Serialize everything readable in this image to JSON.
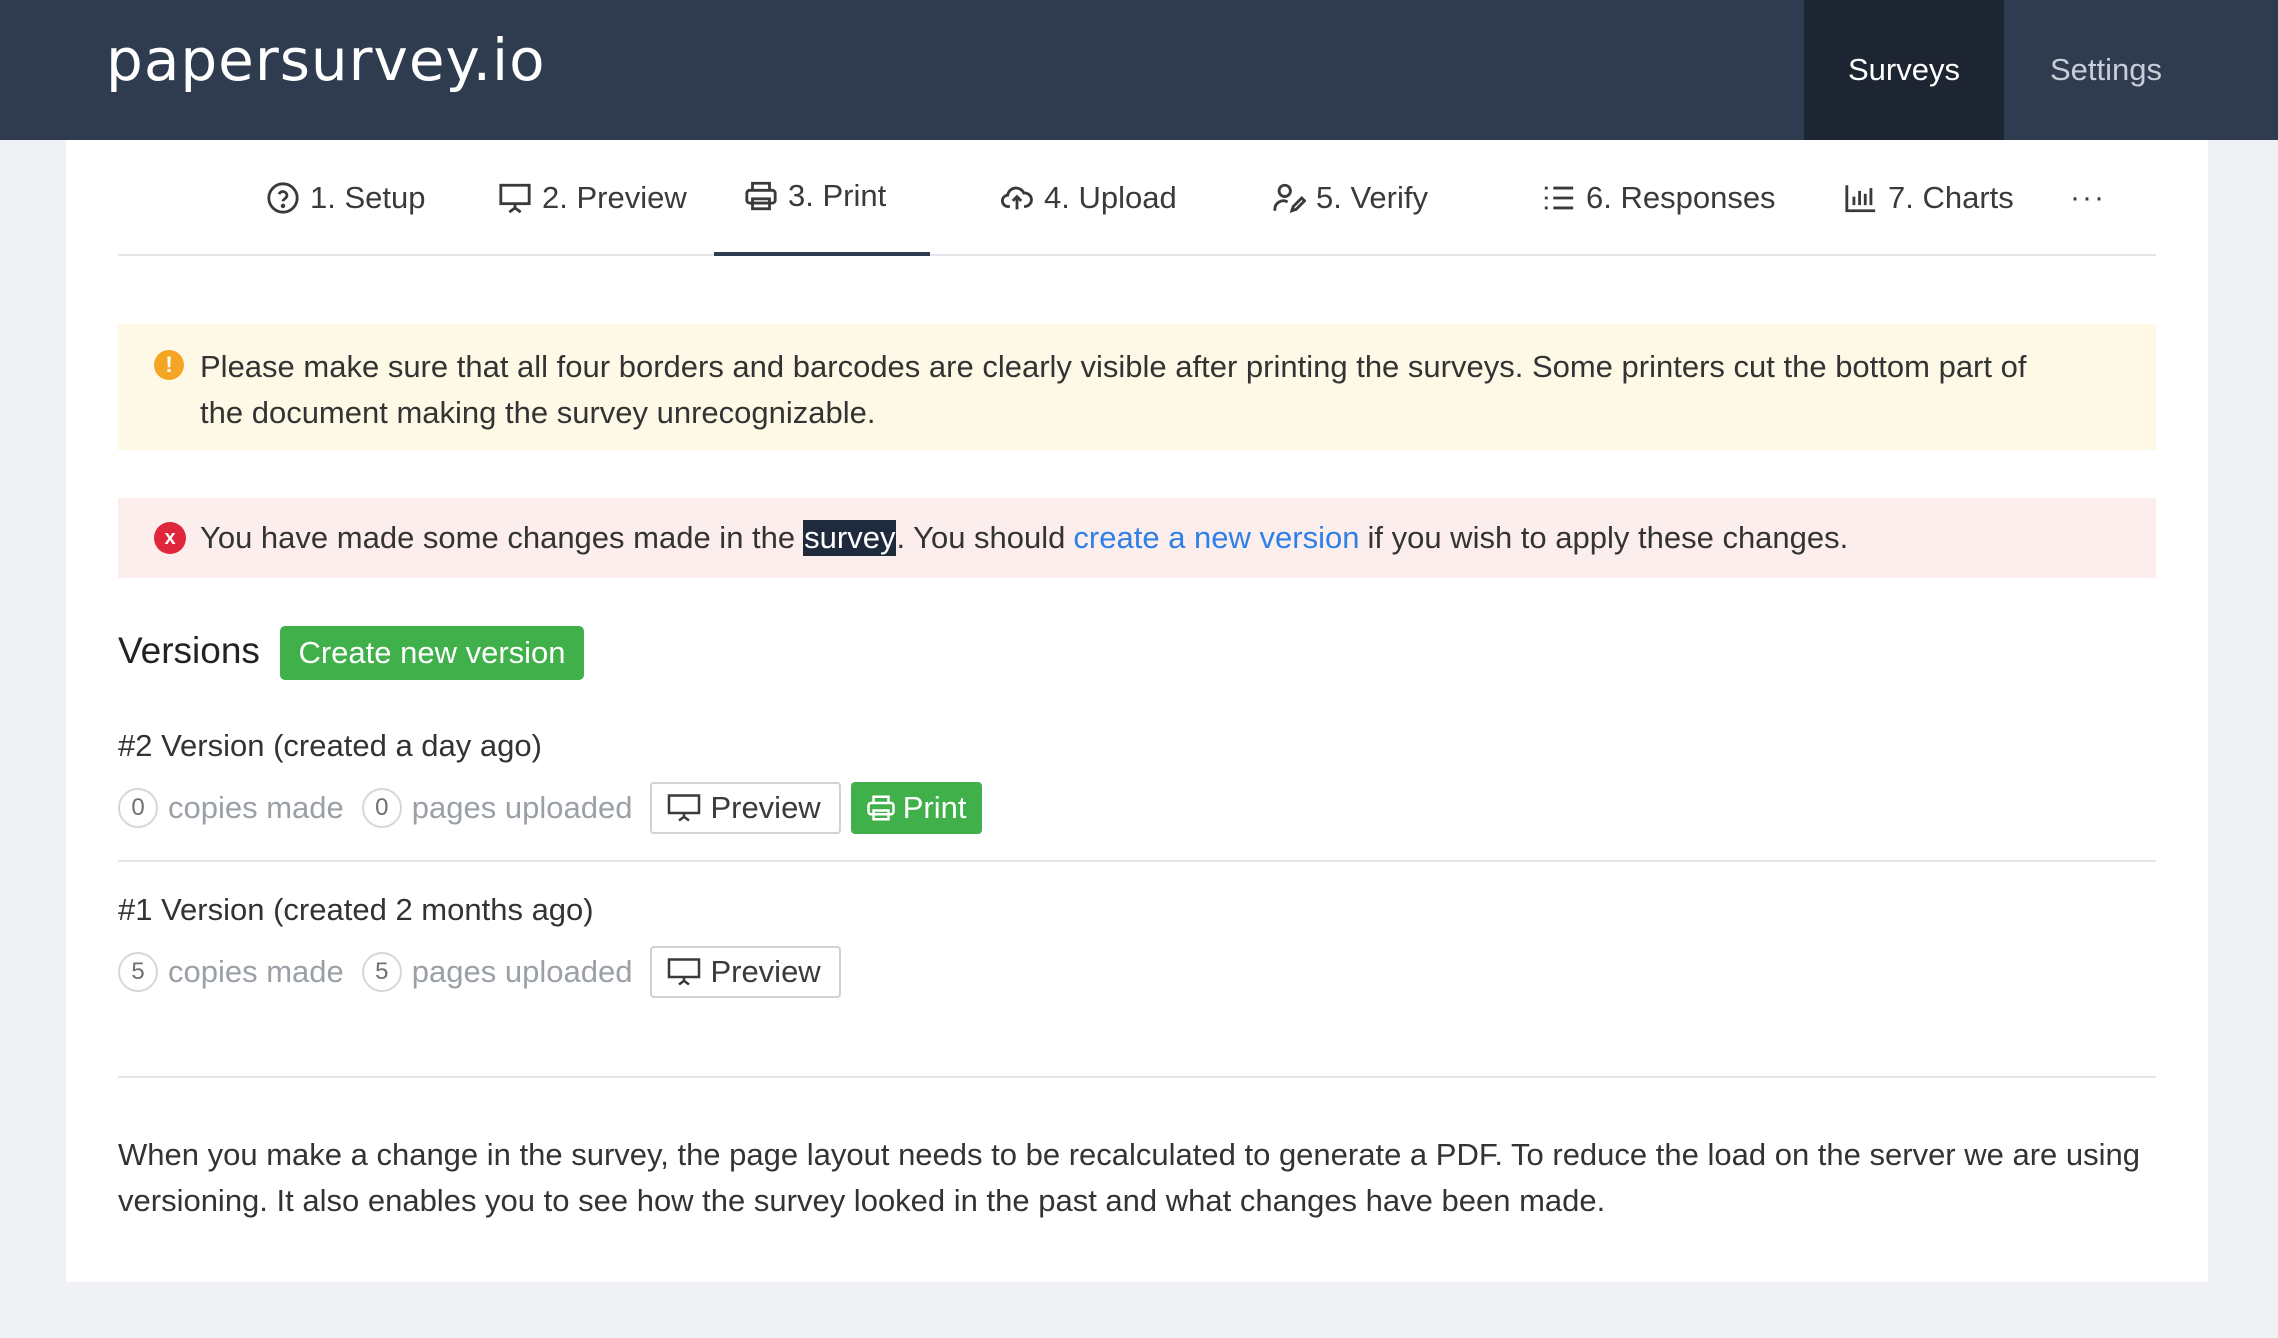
{
  "app": {
    "logo": "papersurvey.io"
  },
  "topnav": {
    "surveys": "Surveys",
    "settings": "Settings"
  },
  "tabs": [
    {
      "label": "1. Setup",
      "icon": "question-circle-icon"
    },
    {
      "label": "2. Preview",
      "icon": "presentation-icon"
    },
    {
      "label": "3. Print",
      "icon": "printer-icon",
      "active": true
    },
    {
      "label": "4. Upload",
      "icon": "cloud-upload-icon"
    },
    {
      "label": "5. Verify",
      "icon": "user-edit-icon"
    },
    {
      "label": "6. Responses",
      "icon": "list-icon"
    },
    {
      "label": "7. Charts",
      "icon": "bar-chart-icon"
    },
    {
      "label": "···",
      "icon": "more-icon"
    }
  ],
  "warning": {
    "icon": "!",
    "text": "Please make sure that all four borders and barcodes are clearly visible after printing the surveys. Some printers cut the bottom part of the document making the survey unrecognizable."
  },
  "error": {
    "icon": "x",
    "pre": "You have made some changes made in the",
    "highlight": "survey",
    "mid": ". You should",
    "link": "create a new version",
    "post": "if you wish to apply these changes."
  },
  "versions": {
    "title": "Versions",
    "create_button": "Create new version",
    "items": [
      {
        "title": "#2 Version (created a day ago)",
        "copies": "0",
        "copies_label": "copies made",
        "pages": "0",
        "pages_label": "pages uploaded",
        "preview_label": "Preview",
        "print_label": "Print"
      },
      {
        "title": "#1 Version (created 2 months ago)",
        "copies": "5",
        "copies_label": "copies made",
        "pages": "5",
        "pages_label": "pages uploaded",
        "preview_label": "Preview"
      }
    ]
  },
  "footer": {
    "text": "When you make a change in the survey, the page layout needs to be recalculated to generate a PDF. To reduce the load on the server we are using versioning. It also enables you to see how the survey looked in the past and what changes have been made."
  },
  "colors": {
    "topbar": "#2f3b4e",
    "active_nav": "#1d2533",
    "green": "#3fb04a",
    "link": "#2f80e6",
    "warning_bg": "#fef9e7",
    "error_bg": "#fdeeee",
    "warning_icon": "#f5a524",
    "error_icon": "#e0263a"
  }
}
